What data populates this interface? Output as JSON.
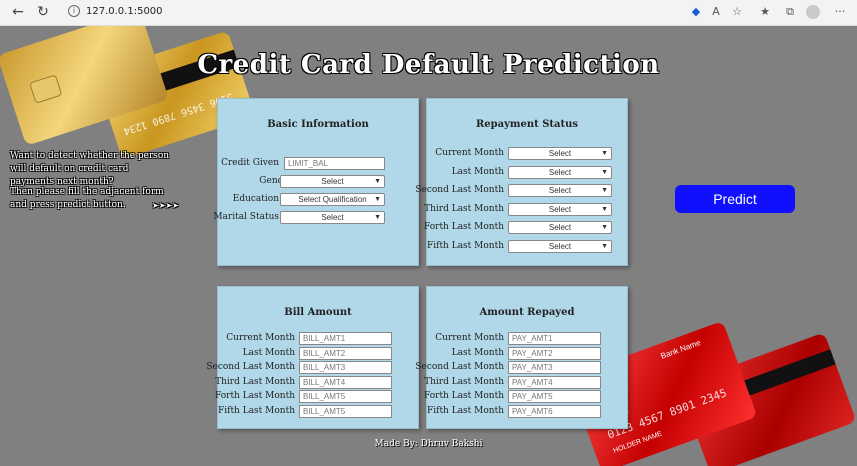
{
  "browser": {
    "url": "127.0.0.1:5000",
    "back_icon": "arrow-left-icon",
    "reload_icon": "reload-icon",
    "info_icon": "info-icon"
  },
  "page": {
    "title": "Credit Card Default Prediction",
    "intro_text": "Want to detect whether the person will default on credit card payments next month?",
    "instructions": "Then please fill the adjacent form and press predict button.",
    "arrows": "➤➤➤➤",
    "footer": "Made By: Dhruv Bakshi"
  },
  "basic_info": {
    "title": "Basic Information",
    "credit_label": "Credit Given",
    "credit_placeholder": "LIMIT_BAL",
    "gender_label": "Gender",
    "gender_value": "Select",
    "education_label": "Education",
    "education_value": "Select Qualification",
    "marital_label": "Marital Status",
    "marital_value": "Select"
  },
  "repayment": {
    "title": "Repayment Status",
    "rows": [
      {
        "label": "Current Month",
        "value": "Select"
      },
      {
        "label": "Last Month",
        "value": "Select"
      },
      {
        "label": "Second Last Month",
        "value": "Select"
      },
      {
        "label": "Third Last Month",
        "value": "Select"
      },
      {
        "label": "Forth Last Month",
        "value": "Select"
      },
      {
        "label": "Fifth Last Month",
        "value": "Select"
      }
    ]
  },
  "bill": {
    "title": "Bill Amount",
    "rows": [
      {
        "label": "Current Month",
        "placeholder": "BILL_AMT1"
      },
      {
        "label": "Last Month",
        "placeholder": "BILL_AMT2"
      },
      {
        "label": "Second Last Month",
        "placeholder": "BILL_AMT3"
      },
      {
        "label": "Third Last Month",
        "placeholder": "BILL_AMT4"
      },
      {
        "label": "Forth Last Month",
        "placeholder": "BILL_AMT5"
      },
      {
        "label": "Fifth Last Month",
        "placeholder": "BILL_AMT5"
      }
    ]
  },
  "repaid": {
    "title": "Amount Repayed",
    "rows": [
      {
        "label": "Current Month",
        "placeholder": "PAY_AMT1"
      },
      {
        "label": "Last Month",
        "placeholder": "PAY_AMT2"
      },
      {
        "label": "Second Last Month",
        "placeholder": "PAY_AMT3"
      },
      {
        "label": "Third Last Month",
        "placeholder": "PAY_AMT4"
      },
      {
        "label": "Forth Last Month",
        "placeholder": "PAY_AMT5"
      },
      {
        "label": "Fifth Last Month",
        "placeholder": "PAY_AMT6"
      }
    ]
  },
  "predict_label": "Predict",
  "cards": {
    "gold_number": "5106 3456 7890 1234",
    "red_bank": "Bank Name",
    "red_number": "0123 4567 8901 2345",
    "red_holder": "HOLDER NAME"
  },
  "colors": {
    "background": "#808080",
    "panel": "#b0d8e8",
    "predict_button": "#1010ff"
  }
}
